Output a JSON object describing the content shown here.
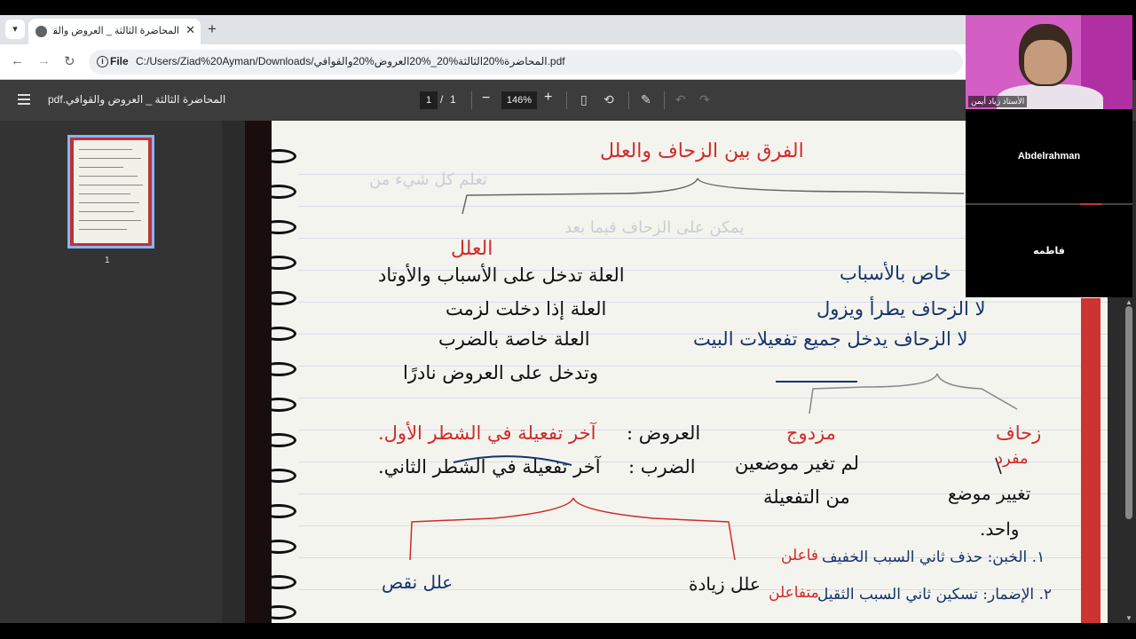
{
  "browser": {
    "tab_title": "المحاضرة الثالثة _ العروض والقوا",
    "tab_dropdown_icon": "chevron-down",
    "url_chip": "File",
    "url": "C:/Users/Ziad%20Ayman/Downloads/المحاضرة%20الثالثة%20_%20العروض%20والقوافي.pdf"
  },
  "pdf_toolbar": {
    "title": "المحاضرة الثالثة _ العروض والقوافي.pdf",
    "current_page": "1",
    "separator": "/",
    "page_count": "1",
    "zoom": "146%"
  },
  "sidebar": {
    "thumb_page_number": "1"
  },
  "notes": {
    "title": "الفرق بين الزحاف والعلل",
    "left_heading": "العلل",
    "left_lines": [
      "العلة تدخل على الأسباب والأوتاد",
      "العلة إذا دخلت لزمت",
      "العلة خاصة بالضرب",
      "وتدخل على العروض نادرًا"
    ],
    "right_lines": [
      "خاص بالأسباب",
      "لا الزحاف يطرأ ويزول",
      "لا الزحاف يدخل جميع تفعيلات البيت"
    ],
    "aroud_label": "العروض :",
    "aroud_def": "آخر تفعيلة في الشطر الأول.",
    "darb_label": "الضرب :",
    "darb_def": "آخر تفعيلة في الشطر الثاني.",
    "mozdawaj": "مزدوج",
    "mozdawaj_def_1": "لم تغير موضعين",
    "mozdawaj_def_2": "من التفعيلة",
    "zehaf": "زحاف",
    "mofrad": "مفرد",
    "mofrad_def_1": "تغيير موضع",
    "mofrad_def_2": "واحد.",
    "naqs": "علل نقص",
    "ziyada": "علل زيادة",
    "khabn": "١. الخبن: حذف ثاني السبب الخفيف",
    "khabn_word": "فاعلن",
    "edmar": "٢. الإضمار: تسكين ثاني السبب الثقيل",
    "edmar_word": "متفاعلن"
  },
  "call": {
    "presenter_label": "الأستاذ زياد أيمن",
    "participant_1": "Abdelrahman",
    "participant_2": "فاطمه"
  },
  "colors": {
    "ink_red": "#d02a2a",
    "ink_black": "#111111",
    "ink_blue": "#16336e",
    "toolbar_bg": "#3c3c3c",
    "cam_bg": "#d35fc4"
  }
}
